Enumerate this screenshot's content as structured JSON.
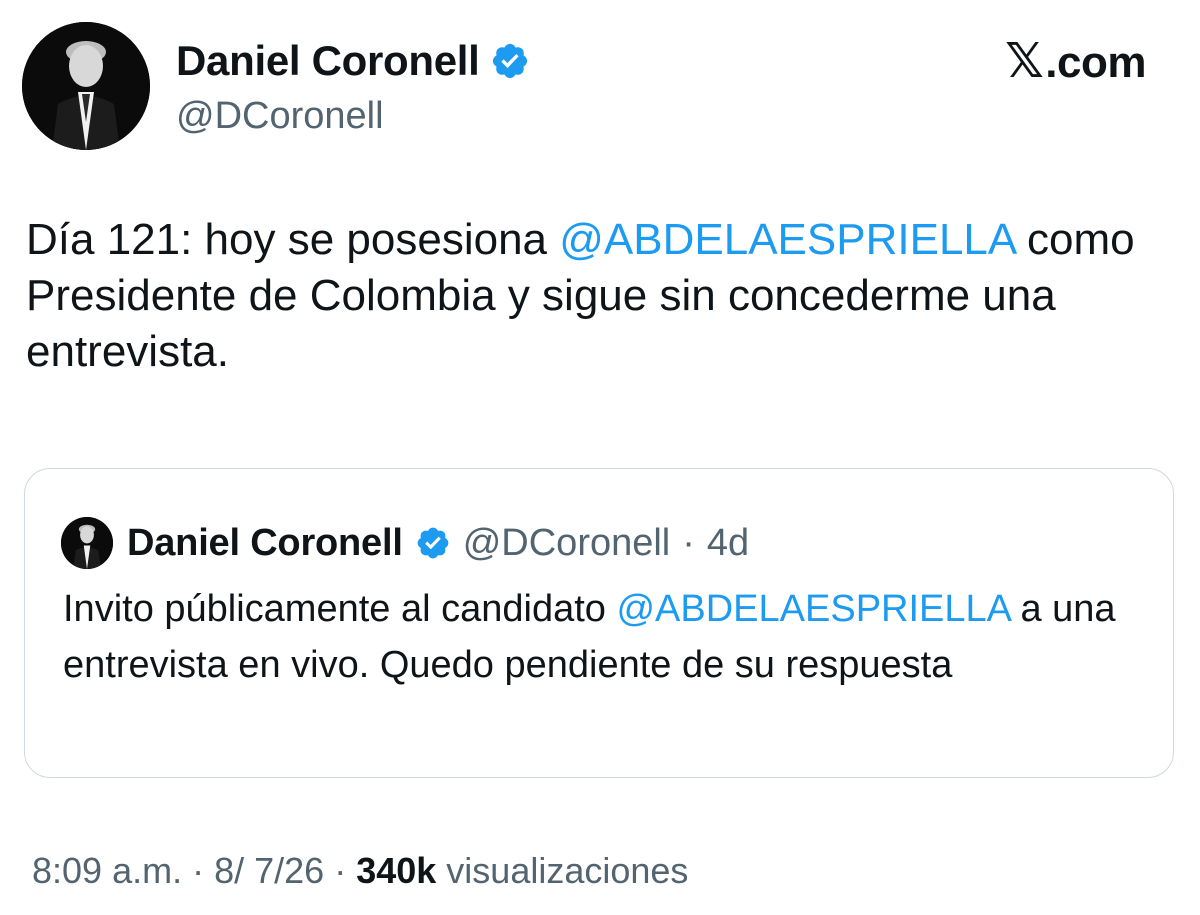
{
  "author": {
    "name": "Daniel Coronell",
    "handle": "@DCoronell"
  },
  "brand": {
    "logo_text": ".com",
    "logo_icon": "x-logo-icon"
  },
  "tweet": {
    "text_before": "Día 121: hoy se posesiona ",
    "mention": "@ABDELAESPRIELLA",
    "text_after": " como Presidente de Colombia y sigue sin concederme una entrevista."
  },
  "quote": {
    "name": "Daniel Coronell",
    "handle": "@DCoronell",
    "separator": "·",
    "time": "4d",
    "text_before": "Invito públicamente al candidato ",
    "mention": "@ABDELAESPRIELLA",
    "text_after": " a una entrevista en vivo. Quedo pendiente de su respuesta"
  },
  "meta": {
    "time": "8:09 a.m.",
    "sep1": "·",
    "date": "8/ 7/26",
    "sep2": "·",
    "views_count": "340k",
    "views_label": "visualizaciones"
  },
  "colors": {
    "link": "#1d9bf0",
    "verified": "#1d9bf0",
    "muted": "#536471",
    "text": "#0f1419",
    "border": "#cfd9de"
  }
}
